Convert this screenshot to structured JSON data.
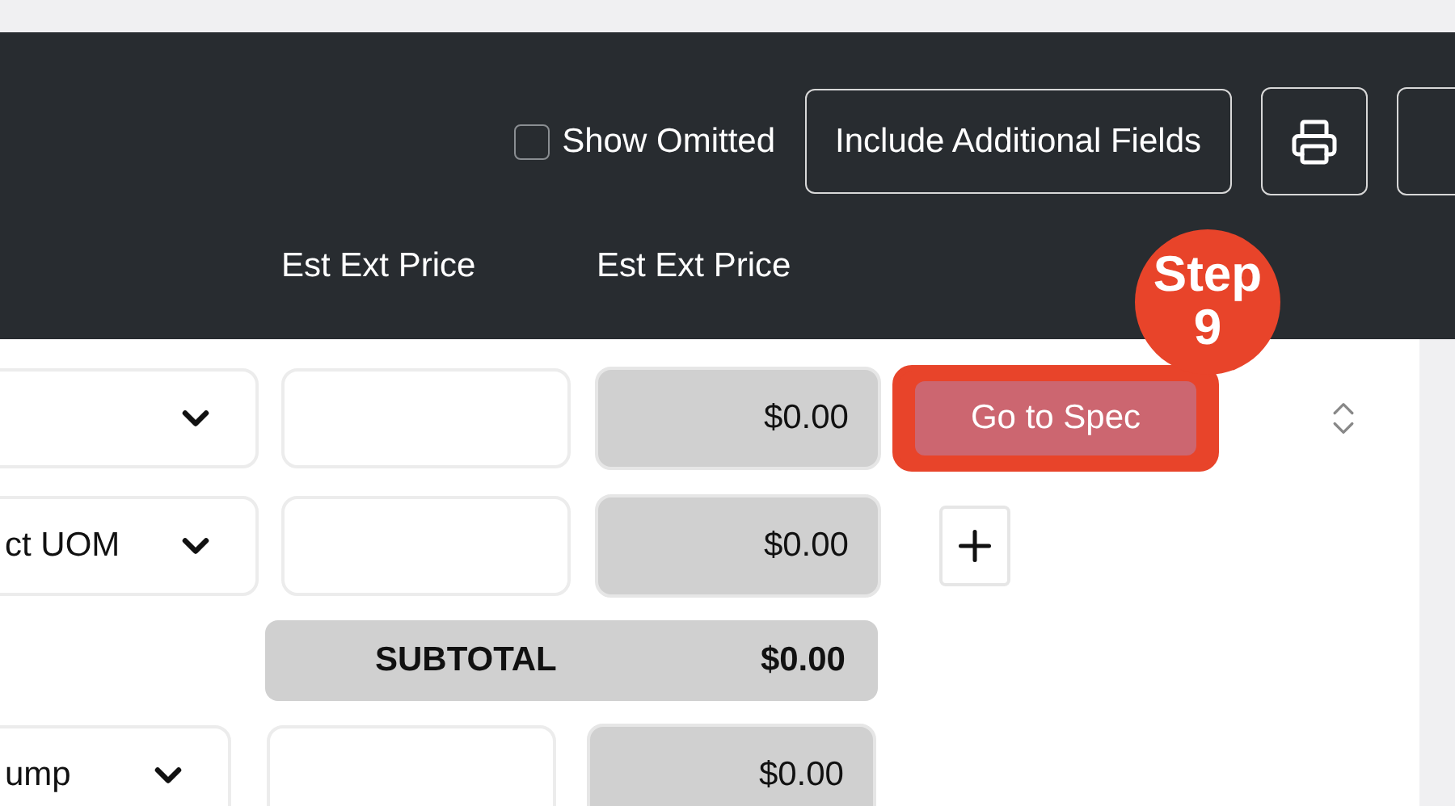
{
  "toolbar": {
    "show_omitted": {
      "label": "Show Omitted",
      "checked": false
    },
    "buttons": [
      {
        "kind": "text",
        "label": "Include Additional Fields"
      },
      {
        "kind": "print"
      },
      {
        "kind": "partial"
      }
    ]
  },
  "columns": [
    "Est Ext Price",
    "Est Ext Price"
  ],
  "rows": [
    {
      "kind": "spec",
      "unit": "",
      "price": "$0.00",
      "action": "Go to Spec",
      "step": "Step 9"
    },
    {
      "kind": "add",
      "unit": "ct UOM",
      "price": "$0.00"
    }
  ],
  "subtotal": {
    "label": "SUBTOTAL",
    "value": "$0.00"
  },
  "next_row": {
    "unit": "ump",
    "price": "$0.00"
  }
}
